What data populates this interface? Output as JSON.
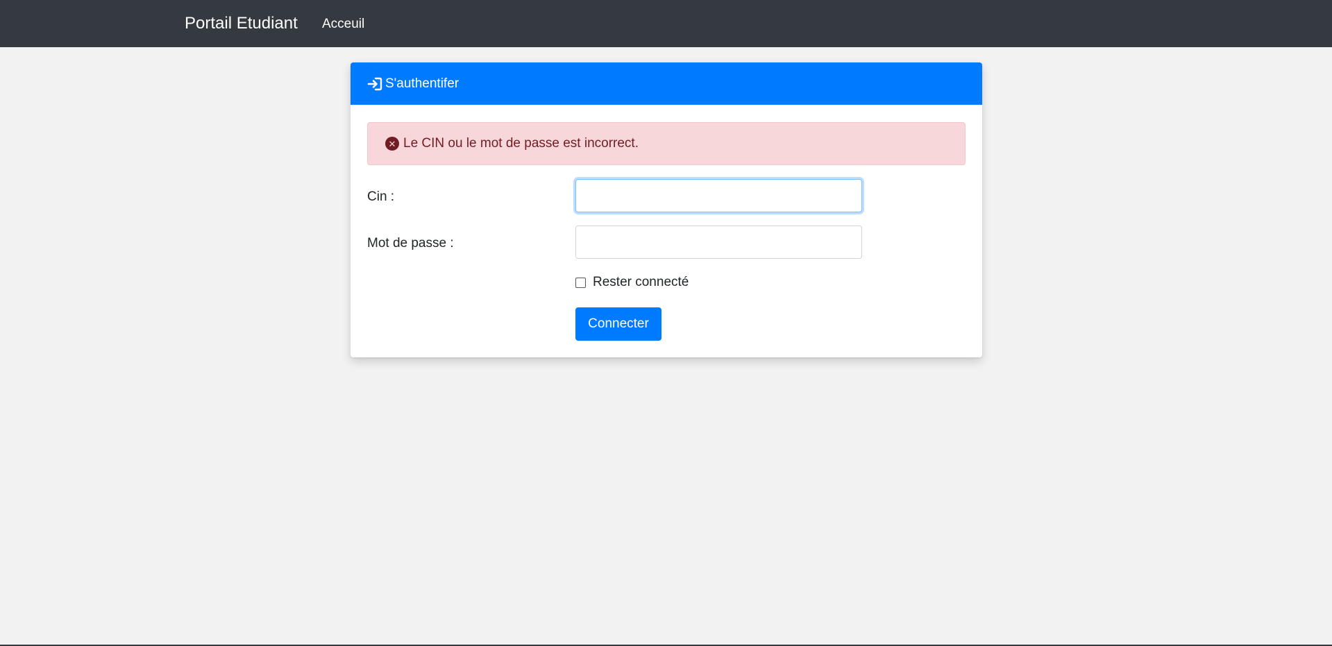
{
  "navbar": {
    "brand": "Portail Etudiant",
    "links": [
      {
        "label": "Acceuil"
      }
    ]
  },
  "login": {
    "header": {
      "title": "S'authentifer",
      "icon": "sign-in-icon"
    },
    "alert": {
      "message": "Le CIN ou le mot de passe est incorrect.",
      "icon": "circle-x-icon"
    },
    "cin": {
      "label": "Cin :",
      "value": "",
      "placeholder": ""
    },
    "password": {
      "label": "Mot de passe :",
      "value": "",
      "placeholder": ""
    },
    "remember": {
      "label": "Rester connecté",
      "checked": false
    },
    "submit_label": "Connecter"
  },
  "colors": {
    "navbar": "#343a40",
    "primary": "#007bff",
    "alert_bg": "#f8d7da",
    "alert_text": "#721c24",
    "page_bg": "#f2f2f2"
  }
}
